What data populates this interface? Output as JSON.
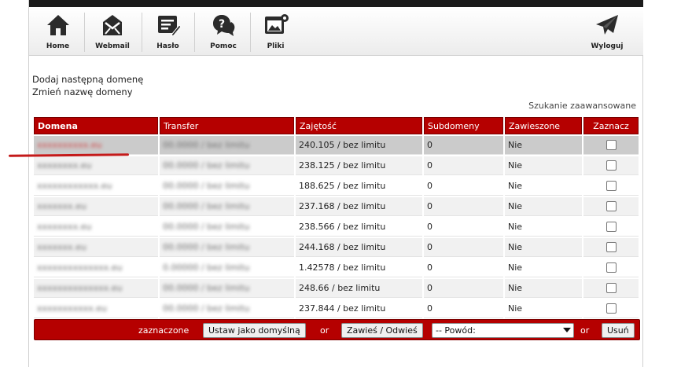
{
  "toolbar": {
    "items": [
      {
        "label": "Home",
        "icon": "home-icon"
      },
      {
        "label": "Webmail",
        "icon": "envelope-icon"
      },
      {
        "label": "Hasło",
        "icon": "password-form-icon"
      },
      {
        "label": "Pomoc",
        "icon": "help-chat-icon"
      },
      {
        "label": "Pliki",
        "icon": "files-icon"
      },
      {
        "label": "Wyloguj",
        "icon": "paper-plane-icon"
      }
    ]
  },
  "links": {
    "add_domain": "Dodaj następną domenę",
    "rename_domain": "Zmień nazwę domeny",
    "advanced_search": "Szukanie zaawansowane"
  },
  "table": {
    "headers": {
      "domain": "Domena",
      "transfer": "Transfer",
      "usage": "Zajętość",
      "subdomains": "Subdomeny",
      "suspended": "Zawieszone",
      "select": "Zaznacz"
    },
    "rows": [
      {
        "domain": "xxxxxxxxxx.eu",
        "transfer": "00.0000 / bez limitu",
        "usage": "240.105 / bez limitu",
        "subdomains": "0",
        "suspended": "Nie",
        "checked": false
      },
      {
        "domain": "xxxxxxxx.eu",
        "transfer": "00.0000 / bez limitu",
        "usage": "238.125 / bez limitu",
        "subdomains": "0",
        "suspended": "Nie",
        "checked": false
      },
      {
        "domain": "xxxxxxxxxxxx.eu",
        "transfer": "00.0000 / bez limitu",
        "usage": "188.625 / bez limitu",
        "subdomains": "0",
        "suspended": "Nie",
        "checked": false
      },
      {
        "domain": "xxxxxxx.eu",
        "transfer": "00.0000 / bez limitu",
        "usage": "237.168 / bez limitu",
        "subdomains": "0",
        "suspended": "Nie",
        "checked": false
      },
      {
        "domain": "xxxxxxxx.eu",
        "transfer": "00.0000 / bez limitu",
        "usage": "238.566 / bez limitu",
        "subdomains": "0",
        "suspended": "Nie",
        "checked": false
      },
      {
        "domain": "xxxxxxx.eu",
        "transfer": "00.0000 / bez limitu",
        "usage": "244.168 / bez limitu",
        "subdomains": "0",
        "suspended": "Nie",
        "checked": false
      },
      {
        "domain": "xxxxxxxxxxxxxx.eu",
        "transfer": "0.00000 / bez limitu",
        "usage": "1.42578 / bez limitu",
        "subdomains": "0",
        "suspended": "Nie",
        "checked": false
      },
      {
        "domain": "xxxxxxxxxxxxxx.eu",
        "transfer": "00.0000 / bez limitu",
        "usage": "248.66 / bez limitu",
        "subdomains": "0",
        "suspended": "Nie",
        "checked": false
      },
      {
        "domain": "xxxxxxxxxxx.eu",
        "transfer": "00.0000 / bez limitu",
        "usage": "237.844 / bez limitu",
        "subdomains": "0",
        "suspended": "Nie",
        "checked": false
      }
    ]
  },
  "actions": {
    "selected_label": "zaznaczone",
    "set_default": "Ustaw jako domyślną",
    "or1": "or",
    "suspend": "Zawieś / Odwieś",
    "reason_selected": "-- Powód:",
    "or2": "or",
    "delete": "Usuń"
  },
  "colors": {
    "header_red": "#b50000",
    "row_highlight": "#cbcbcb",
    "row_alt": "#f1f1f1"
  }
}
